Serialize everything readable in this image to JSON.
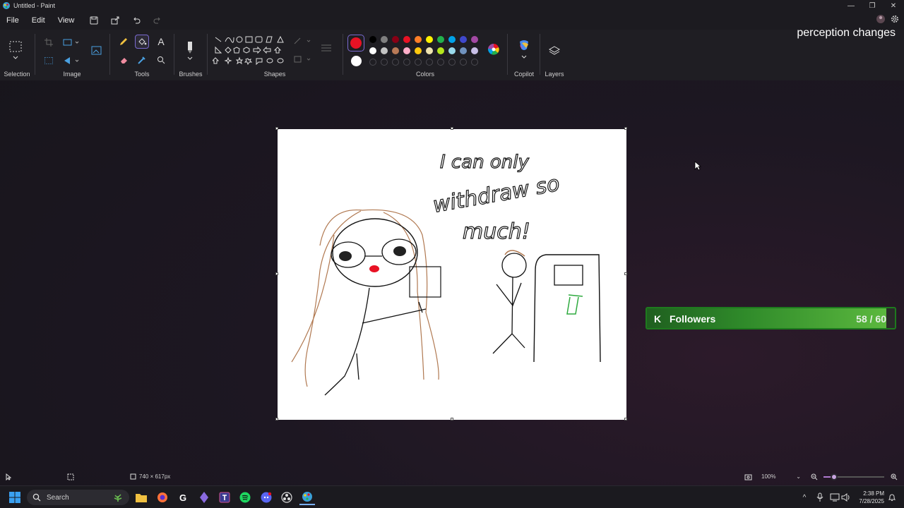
{
  "window": {
    "title": "Untitled - Paint"
  },
  "menu": {
    "file": "File",
    "edit": "Edit",
    "view": "View"
  },
  "ribbon": {
    "groups": {
      "selection": "Selection",
      "image": "Image",
      "tools": "Tools",
      "brushes": "Brushes",
      "shapes": "Shapes",
      "colors": "Colors",
      "copilot": "Copilot",
      "layers": "Layers"
    },
    "colors": {
      "primary": "#e81224",
      "secondary": "#ffffff",
      "palette_row1": [
        "#000000",
        "#7f7f7f",
        "#880015",
        "#e81224",
        "#ff7f27",
        "#fff200",
        "#22b14c",
        "#00a2e8",
        "#3f48cc",
        "#a349a4"
      ],
      "palette_row2": [
        "#ffffff",
        "#c3c3c3",
        "#b97a57",
        "#ffaec9",
        "#ffc90e",
        "#efe4b0",
        "#b5e61d",
        "#99d9ea",
        "#7092be",
        "#c8bfe7"
      ]
    }
  },
  "overlay": {
    "text": "perception changes"
  },
  "canvas": {
    "handwriting": {
      "line1": "I can only",
      "line2": "withdraw so",
      "line3": "much!"
    }
  },
  "followers_widget": {
    "label": "Followers",
    "count": "58 / 60",
    "progress": 0.967,
    "accent": "#5bb83e"
  },
  "statusbar": {
    "canvas_size": "740 × 617px",
    "zoom": "100%"
  },
  "taskbar": {
    "search_placeholder": "Search",
    "time": "2:38 PM",
    "date": "7/28/2025"
  }
}
